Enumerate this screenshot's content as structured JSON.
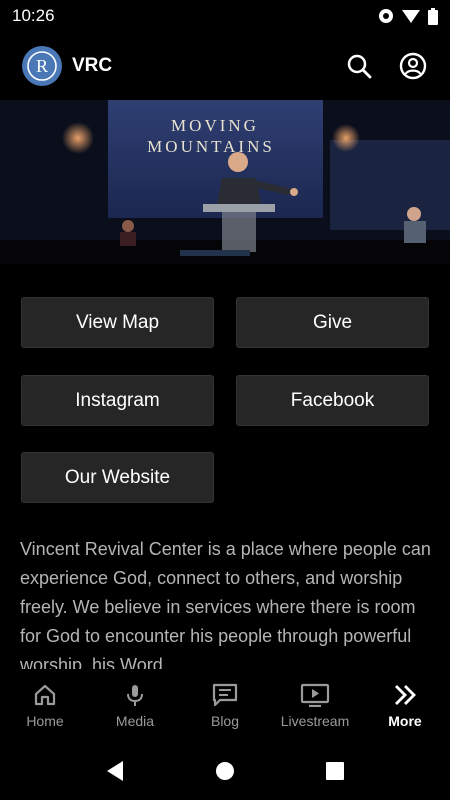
{
  "status_bar": {
    "time": "10:26"
  },
  "app_bar": {
    "logo_letter": "R",
    "title": "VRC"
  },
  "hero": {
    "title_line1": "MOVING",
    "title_line2": "MOUNTAINS"
  },
  "buttons": {
    "view_map": "View Map",
    "give": "Give",
    "instagram": "Instagram",
    "facebook": "Facebook",
    "website": "Our Website"
  },
  "description": "Vincent Revival Center is a place where people can experience God, connect to others, and worship freely. We believe in services where there is room for God to encounter his people through powerful worship, his Word,",
  "bottom_nav": [
    {
      "label": "Home",
      "icon": "home-icon"
    },
    {
      "label": "Media",
      "icon": "microphone-icon"
    },
    {
      "label": "Blog",
      "icon": "blog-icon"
    },
    {
      "label": "Livestream",
      "icon": "livestream-icon"
    },
    {
      "label": "More",
      "icon": "chevrons-right-icon"
    }
  ],
  "colors": {
    "background": "#000000",
    "button": "#262626",
    "logo": "#4a78b6",
    "muted_text": "#b5b5b5"
  }
}
